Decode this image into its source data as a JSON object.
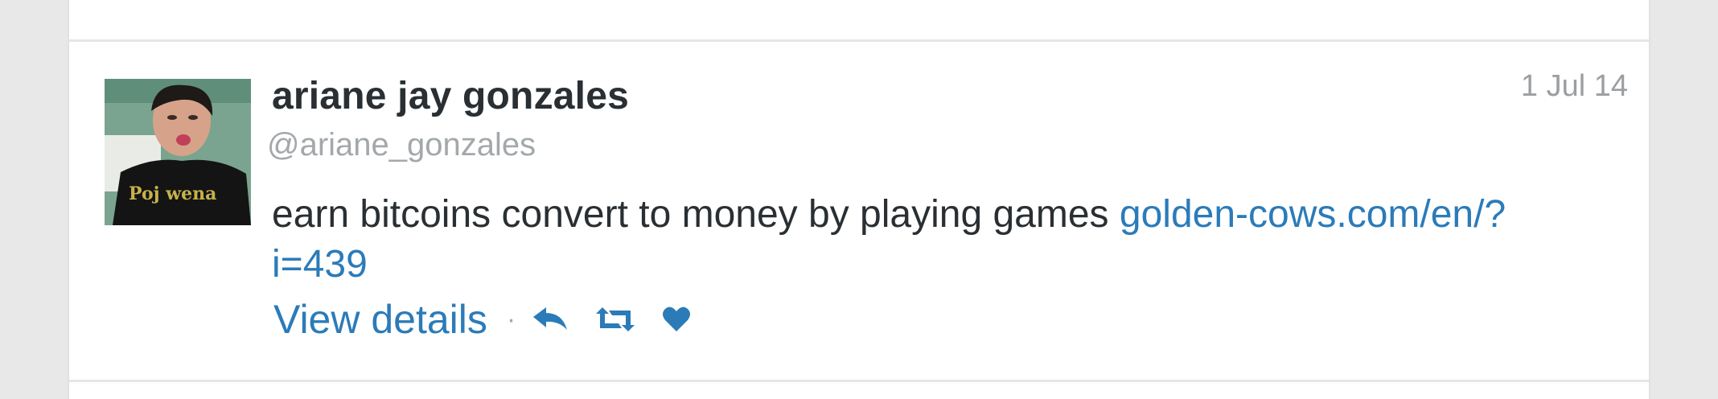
{
  "tweet": {
    "full_name": "ariane jay gonzales",
    "username": "@ariane_gonzales",
    "timestamp": "1 Jul 14",
    "text": "earn bitcoins convert to money by playing games ",
    "link_text": "golden-cows.com/en/?i=439",
    "avatar_shirt_text": "Poj wena",
    "actions": {
      "view_details": "View details",
      "separator": "·",
      "reply_icon": "reply-icon",
      "retweet_icon": "retweet-icon",
      "favorite_icon": "heart-icon"
    }
  },
  "colors": {
    "link": "#2b7bb9",
    "name": "#292f33",
    "muted": "#a3a8ab",
    "divider": "#e6e6e6",
    "background": "#e8e8e8"
  }
}
